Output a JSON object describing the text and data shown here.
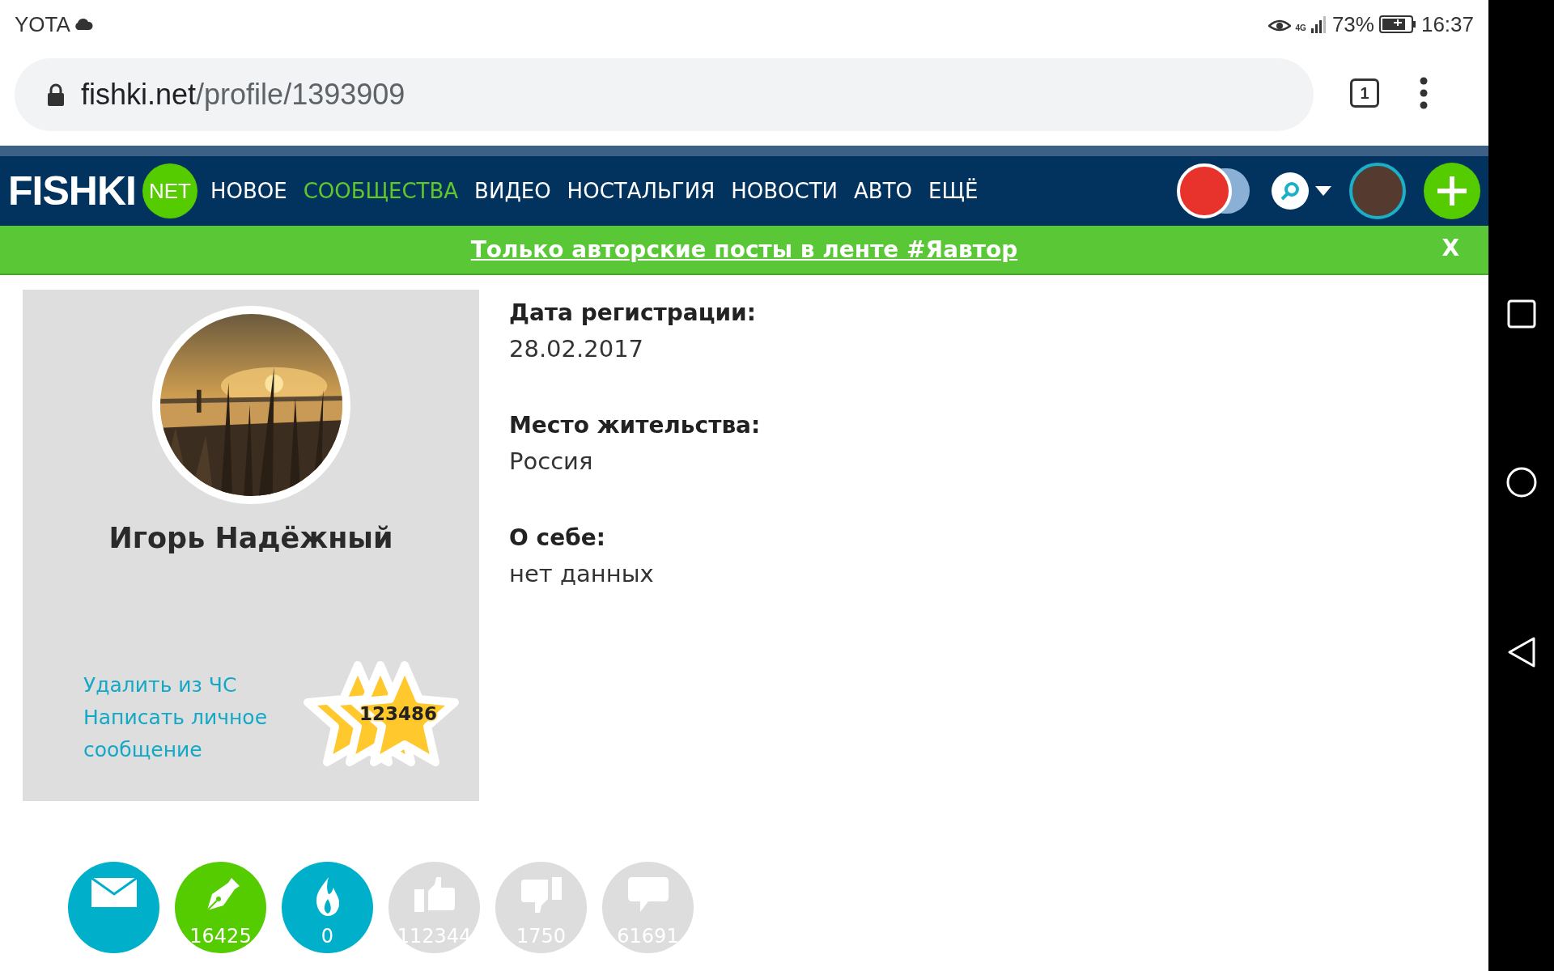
{
  "status_bar": {
    "carrier": "YOTA",
    "signal_label": "4G",
    "battery": "73%",
    "time": "16:37"
  },
  "address_bar": {
    "domain": "fishki.net",
    "path": "/profile/1393909",
    "tab_count": "1"
  },
  "site_header": {
    "logo": "FISHKI",
    "logo_badge": "NET",
    "menu": [
      {
        "label": "НОВОЕ",
        "selected": false
      },
      {
        "label": "СООБЩЕСТВА",
        "selected": true
      },
      {
        "label": "ВИДЕО",
        "selected": false
      },
      {
        "label": "НОСТАЛЬГИЯ",
        "selected": false
      },
      {
        "label": "НОВОСТИ",
        "selected": false
      },
      {
        "label": "АВТО",
        "selected": false
      },
      {
        "label": "ЕЩЁ",
        "selected": false
      }
    ]
  },
  "banner": {
    "text": "Только авторские посты в ленте #Яавтор",
    "close": "X"
  },
  "profile": {
    "name": "Игорь Надёжный",
    "links": [
      "Удалить из ЧС",
      "Написать личное сообщение"
    ],
    "rating": "123486",
    "fields": [
      {
        "label": "Дата регистрации:",
        "value": "28.02.2017"
      },
      {
        "label": "Место жительства:",
        "value": "Россия"
      },
      {
        "label": "О себе:",
        "value": "нет данных"
      }
    ]
  },
  "stats": [
    {
      "kind": "mail",
      "color": "#00afc9"
    },
    {
      "kind": "posts",
      "value": "16425",
      "color": "#55cc00"
    },
    {
      "kind": "fire",
      "value": "0",
      "color": "#00afc9"
    },
    {
      "kind": "likes",
      "value": "112344",
      "color": "#dddddd"
    },
    {
      "kind": "dislikes",
      "value": "1750",
      "color": "#dddddd"
    },
    {
      "kind": "comments",
      "value": "61691",
      "color": "#dddddd"
    }
  ]
}
